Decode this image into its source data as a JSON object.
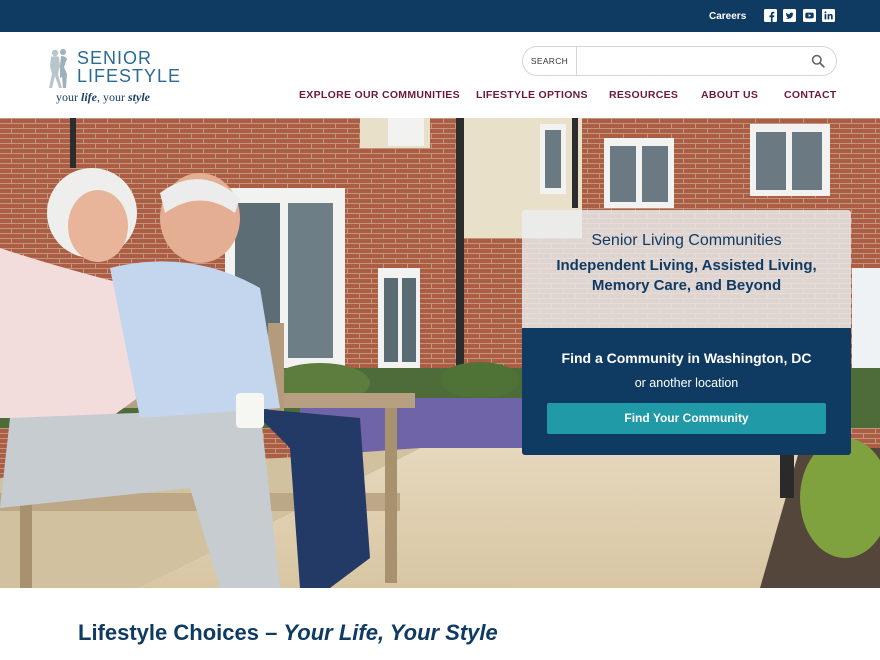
{
  "topbar": {
    "careers": "Careers",
    "social": [
      "facebook-icon",
      "twitter-icon",
      "youtube-icon",
      "linkedin-icon"
    ],
    "bg_color": "#0f3b63"
  },
  "logo": {
    "line1": "SENIOR",
    "line2": "LIFESTYLE",
    "tag_prefix": "your ",
    "tag_life": "life",
    "tag_mid": ", your ",
    "tag_style": "style"
  },
  "search": {
    "label": "SEARCH",
    "value": "",
    "placeholder": ""
  },
  "nav": [
    "EXPLORE OUR COMMUNITIES",
    "LIFESTYLE OPTIONS",
    "RESOURCES",
    "ABOUT US",
    "CONTACT"
  ],
  "hero": {
    "card_title": "Senior Living Communities",
    "card_subtitle": "Independent Living, Assisted Living, Memory Care, and Beyond",
    "find_title": "Find a Community in Washington, DC",
    "find_alt": "or another location",
    "button": "Find Your Community"
  },
  "section": {
    "title_a": "Lifestyle Choices – ",
    "title_b": "Your Life, Your Style"
  },
  "colors": {
    "navy": "#0f3b63",
    "nav_text": "#6b1a3a",
    "teal_button": "#1f9aa6"
  }
}
